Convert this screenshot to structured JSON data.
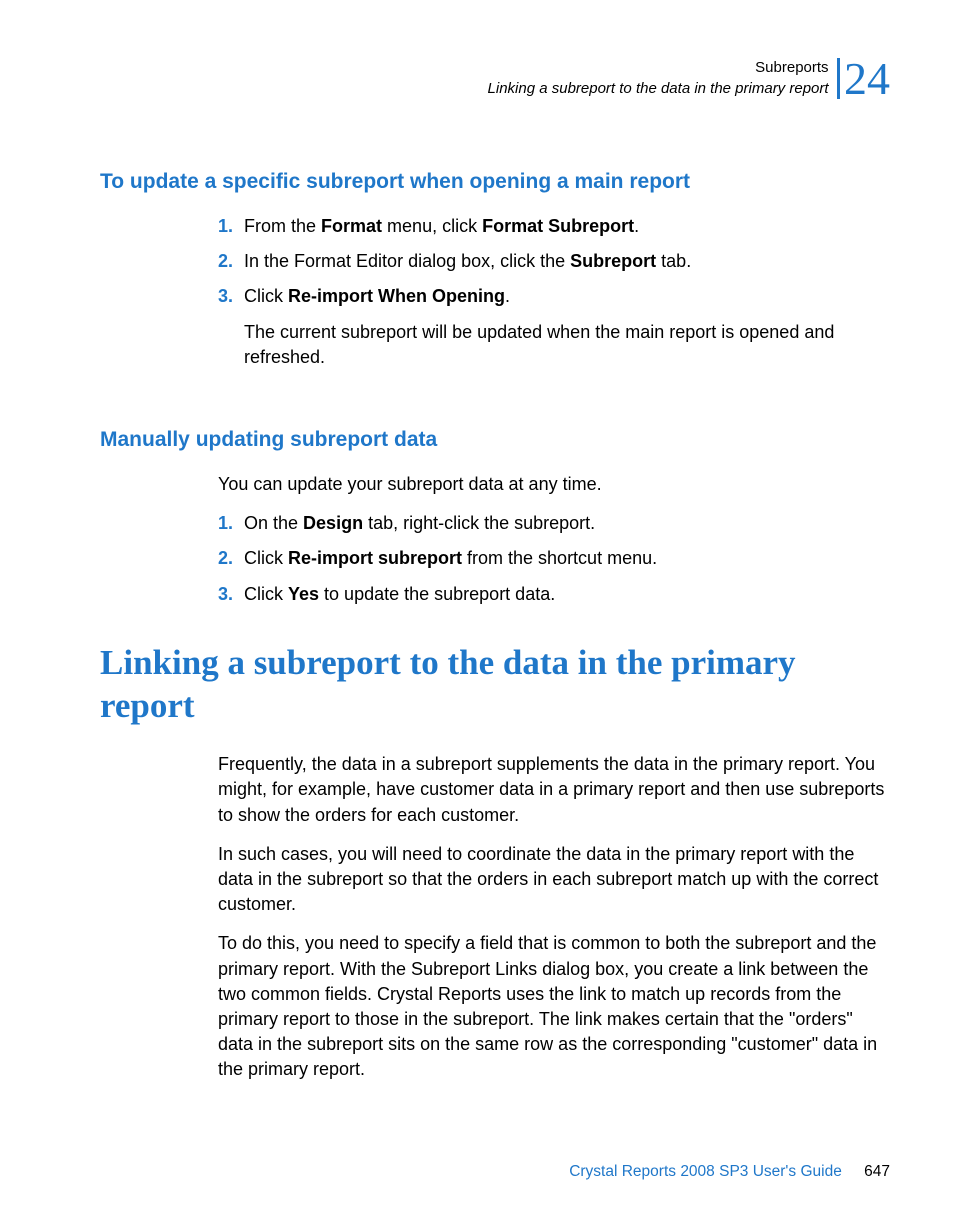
{
  "header": {
    "line1": "Subreports",
    "line2": "Linking a subreport to the data in the primary report",
    "chapter_number": "24"
  },
  "section1": {
    "title": "To update a specific subreport when opening a main report",
    "steps": [
      {
        "num": "1.",
        "pre": "From the ",
        "b1": "Format",
        "mid": " menu, click ",
        "b2": "Format Subreport",
        "post": "."
      },
      {
        "num": "2.",
        "pre": "In the Format Editor dialog box, click the ",
        "b1": "Subreport",
        "mid": " tab.",
        "b2": "",
        "post": ""
      },
      {
        "num": "3.",
        "pre": "Click ",
        "b1": "Re-import When Opening",
        "mid": ".",
        "b2": "",
        "post": ""
      }
    ],
    "result": "The current subreport will be updated when the main report is opened and refreshed."
  },
  "section2": {
    "title": "Manually updating subreport data",
    "intro": "You can update your subreport data at any time.",
    "steps": [
      {
        "num": "1.",
        "pre": "On the ",
        "b1": "Design",
        "mid": " tab, right-click the subreport.",
        "b2": "",
        "post": ""
      },
      {
        "num": "2.",
        "pre": "Click ",
        "b1": "Re-import subreport",
        "mid": " from the shortcut menu.",
        "b2": "",
        "post": ""
      },
      {
        "num": "3.",
        "pre": "Click ",
        "b1": "Yes",
        "mid": " to update the subreport data.",
        "b2": "",
        "post": ""
      }
    ]
  },
  "h1": "Linking a subreport to the data in the primary report",
  "body": {
    "p1": "Frequently, the data in a subreport supplements the data in the primary report. You might, for example, have customer data in a primary report and then use subreports to show the orders for each customer.",
    "p2": "In such cases, you will need to coordinate the data in the primary report with the data in the subreport so that the orders in each subreport match up with the correct customer.",
    "p3": "To do this, you need to specify a field that is common to both the subreport and the primary report. With the Subreport Links dialog box, you create a link between the two common fields. Crystal Reports uses the link to match up records from the primary report to those in the subreport. The link makes certain that the \"orders\" data in the subreport sits on the same row as the corresponding \"customer\" data in the primary report."
  },
  "footer": {
    "title": "Crystal Reports 2008 SP3 User's Guide",
    "page": "647"
  }
}
